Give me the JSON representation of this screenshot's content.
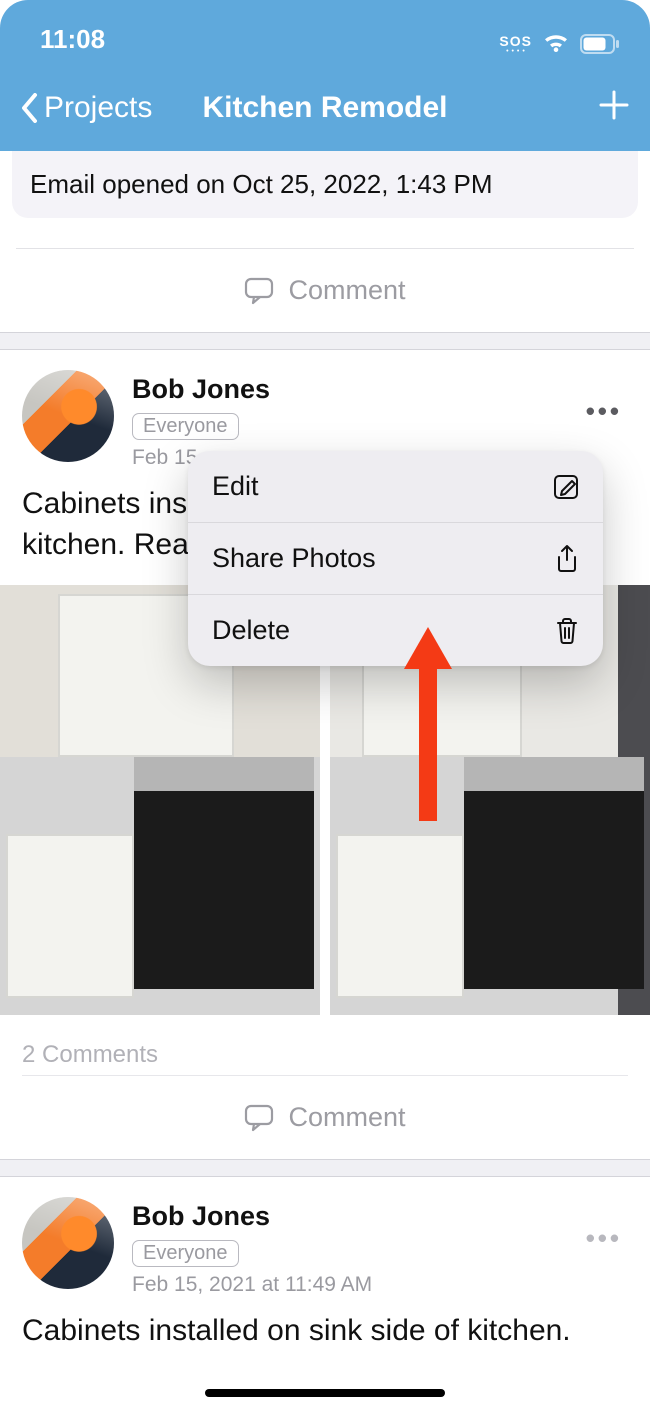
{
  "statusbar": {
    "time": "11:08",
    "sos": "SOS"
  },
  "nav": {
    "back": "Projects",
    "title": "Kitchen Remodel"
  },
  "email_card": {
    "text": "Email opened on Oct 25, 2022, 1:43 PM"
  },
  "comment_label": "Comment",
  "post1": {
    "author": "Bob Jones",
    "visibility": "Everyone",
    "timestamp_partial": "Feb 15,",
    "body_visible": "Cabinets ins\nkitchen. Rea",
    "comments_count": "2 Comments"
  },
  "post2": {
    "author": "Bob Jones",
    "visibility": "Everyone",
    "timestamp": "Feb 15, 2021 at 11:49 AM",
    "body": "Cabinets installed on sink side of kitchen."
  },
  "menu": {
    "edit": "Edit",
    "share": "Share Photos",
    "delete": "Delete"
  }
}
